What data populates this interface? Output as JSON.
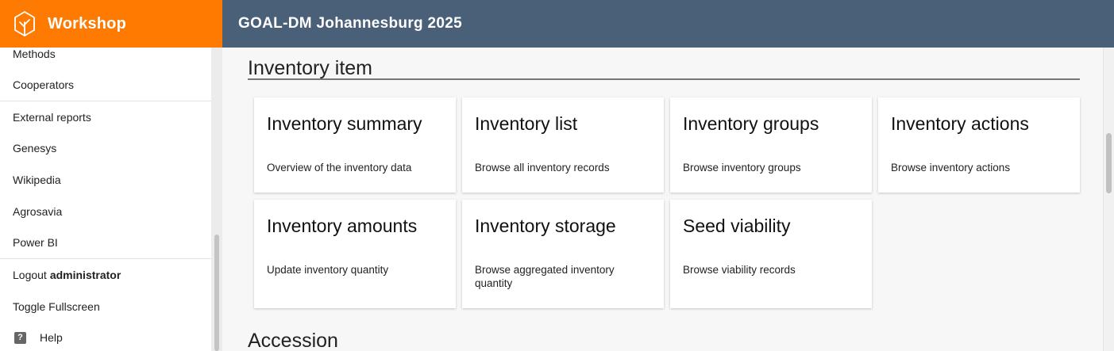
{
  "brand": {
    "name": "Workshop",
    "logo_icon": "seed-logo-icon",
    "color": "#ff7a00"
  },
  "header": {
    "title": "GOAL-DM Johannesburg 2025",
    "color": "#4a6078"
  },
  "sidebar": {
    "items": [
      {
        "label": "Methods"
      },
      {
        "label": "Cooperators"
      },
      {
        "label": "External reports"
      },
      {
        "label": "Genesys"
      },
      {
        "label": "Wikipedia"
      },
      {
        "label": "Agrosavia"
      },
      {
        "label": "Power BI"
      },
      {
        "label": "Logout",
        "user": "administrator"
      },
      {
        "label": "Toggle Fullscreen"
      },
      {
        "label": "Help",
        "icon": "help-icon",
        "icon_glyph": "?"
      }
    ]
  },
  "main": {
    "section_title": "Inventory item",
    "next_section_title": "Accession",
    "cards": [
      {
        "title": "Inventory summary",
        "description": "Overview of the inventory data"
      },
      {
        "title": "Inventory list",
        "description": "Browse all inventory records"
      },
      {
        "title": "Inventory groups",
        "description": "Browse inventory groups"
      },
      {
        "title": "Inventory actions",
        "description": "Browse inventory actions"
      },
      {
        "title": "Inventory amounts",
        "description": "Update inventory quantity"
      },
      {
        "title": "Inventory storage",
        "description": "Browse aggregated inventory quantity"
      },
      {
        "title": "Seed viability",
        "description": "Browse viability records"
      }
    ]
  }
}
